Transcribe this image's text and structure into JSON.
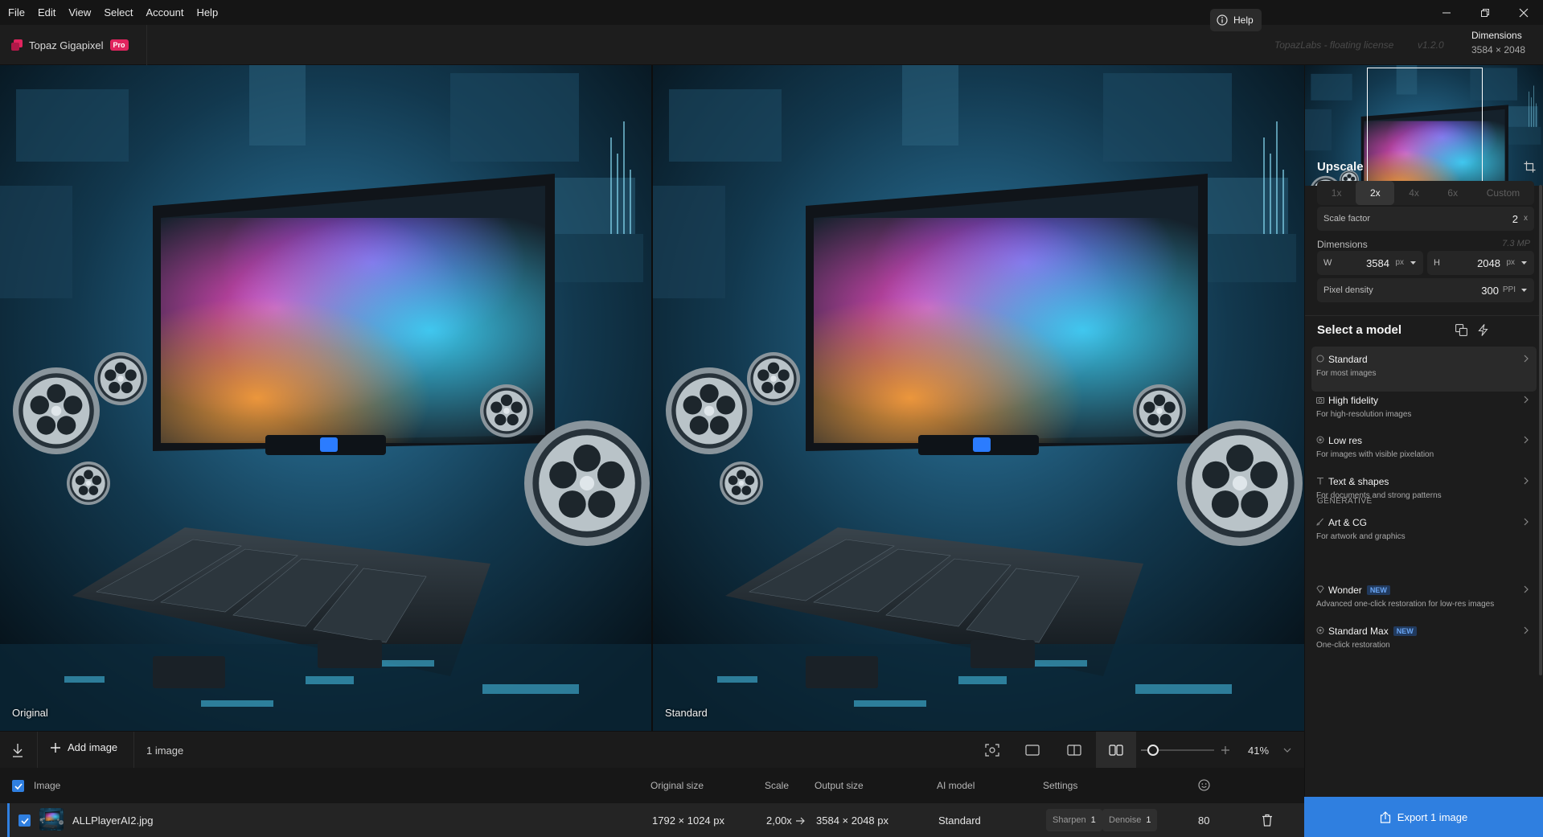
{
  "menu": [
    "File",
    "Edit",
    "View",
    "Select",
    "Account",
    "Help"
  ],
  "app": {
    "name": "Topaz Gigapixel",
    "badge": "Pro"
  },
  "header": {
    "help_label": "Help",
    "license": "TopazLabs - floating license",
    "version": "v1.2.0",
    "dimensions_label": "Dimensions",
    "dimensions_value": "3584 × 2048"
  },
  "viewer": {
    "left_label": "Original",
    "right_label": "Standard"
  },
  "toolbar": {
    "add_image": "Add image",
    "image_count": "1 image",
    "zoom": "41%",
    "zoom_level": 0.05
  },
  "table": {
    "headers": {
      "image": "Image",
      "original_size": "Original size",
      "scale": "Scale",
      "output_size": "Output size",
      "ai_model": "AI model",
      "settings": "Settings"
    },
    "rows": [
      {
        "filename": "ALLPlayerAI2.jpg",
        "original_size": "1792 × 1024 px",
        "scale": "2,00x",
        "output_size": "3584 × 2048 px",
        "model": "Standard",
        "sharpen_label": "Sharpen",
        "sharpen": "1",
        "denoise_label": "Denoise",
        "denoise": "1",
        "score": "80"
      }
    ]
  },
  "upscale": {
    "title": "Upscale",
    "options": [
      "1x",
      "2x",
      "4x",
      "6x",
      "Custom"
    ],
    "selected": "2x",
    "scale_factor_label": "Scale factor",
    "scale_factor_value": "2",
    "scale_factor_unit": "x",
    "dimensions_label": "Dimensions",
    "megapixels": "7.3 MP",
    "w_label": "W",
    "w_value": "3584",
    "w_unit": "px",
    "h_label": "H",
    "h_value": "2048",
    "h_unit": "px",
    "density_label": "Pixel density",
    "density_value": "300",
    "density_unit": "PPI"
  },
  "models": {
    "title": "Select a model",
    "generative_label": "GENERATIVE",
    "new_badge": "NEW",
    "items": [
      {
        "name": "Standard",
        "desc": "For most images",
        "selected": true
      },
      {
        "name": "High fidelity",
        "desc": "For high-resolution images"
      },
      {
        "name": "Low res",
        "desc": "For images with visible pixelation"
      },
      {
        "name": "Text & shapes",
        "desc": "For documents and strong patterns"
      },
      {
        "name": "Art & CG",
        "desc": "For artwork and graphics"
      }
    ],
    "generative": [
      {
        "name": "Wonder",
        "desc": "Advanced one-click restoration for low-res images",
        "is_new": true
      },
      {
        "name": "Standard Max",
        "desc": "One-click restoration",
        "is_new": true
      }
    ]
  },
  "export_label": "Export 1 image",
  "colors": {
    "accent": "#2f7fe0",
    "pro_badge": "#e0245e",
    "panel": "#1c1c1c"
  }
}
